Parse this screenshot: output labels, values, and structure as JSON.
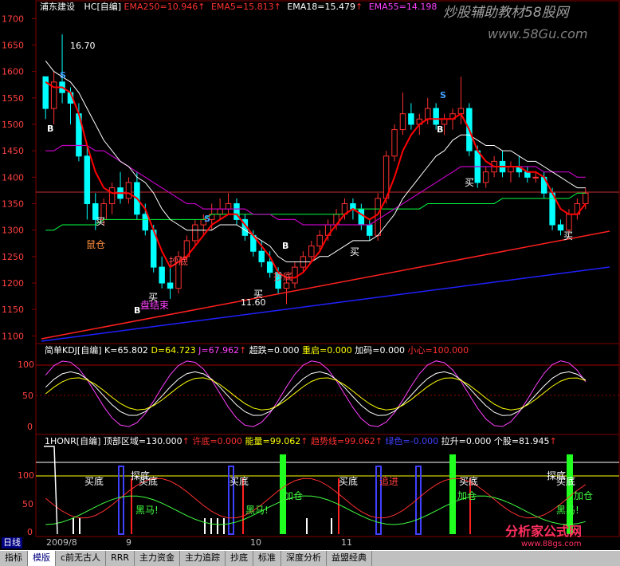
{
  "window": {
    "stock_name": "浦东建设",
    "pane1_formula": "HC[自编]",
    "ema250_label": "EMA250=10.946",
    "ema5_label": "EMA5=15.813",
    "ema18_label": "EMA18=15.479",
    "ema55_label": "EMA55=14.198",
    "arrow": "↑",
    "watermark_top": "炒股辅助教材58股网",
    "watermark_url": "www.58Gu.com",
    "watermark_bottom": "分析家公式网",
    "watermark_bottom_url": "www.88gs.com"
  },
  "colors": {
    "up": "#ff3030",
    "down": "#00ffff",
    "ema5": "#ff0000",
    "ema18": "#ffffff",
    "ema55": "#c000c0",
    "ema250": "#00ff40",
    "long1": "#ff2020",
    "long2": "#2020ff",
    "grid": "#800000"
  },
  "price_axis": {
    "ticks": [
      "1700",
      "1650",
      "1600",
      "1550",
      "1500",
      "1450",
      "1400",
      "1350",
      "1300",
      "1250",
      "1200",
      "1150",
      "1100"
    ]
  },
  "annotations": {
    "high_price": "16.70",
    "low_price": "11.60",
    "buy": "买",
    "s_mark": "S",
    "b_mark": "B",
    "mouse_cang": "鼠仓",
    "chao_di": "抄底",
    "pan_jie_shu": "盘结束"
  },
  "kdj_header": {
    "name": "简单KDJ[自编]",
    "k": "K=65.802",
    "d": "D=64.723",
    "j": "J=67.962",
    "chao_die": "超跌=0.000",
    "chong_qi": "重启=0.000",
    "jia_ma": "加码=0.000",
    "xiao_xin": "小心=100.000",
    "ticks": [
      "100",
      "50",
      "0"
    ]
  },
  "honr_header": {
    "name": "1HONR[自编]",
    "ding_bu": "顶部区域=130.000",
    "xu_di": "许底=0.000",
    "neng_liang": "能量=99.062",
    "qu_shi_xian": "趋势线=99.062",
    "lu_se": "绿色=-0.000",
    "la_sheng": "拉升=0.000",
    "ge_gu": "个股=81.945",
    "ticks": [
      "100",
      "50",
      "0"
    ],
    "mai_di": "买底",
    "tan_di": "探底",
    "hei_ma": "黑马!",
    "jia_cang": "加仓",
    "zhui_jin": "追进"
  },
  "date_axis": {
    "labels": [
      "2009/8",
      "9",
      "10",
      "11"
    ]
  },
  "tabs": [
    {
      "label": "日线",
      "active": false
    },
    {
      "label": "指标",
      "active": false
    },
    {
      "label": "模版",
      "active": true
    },
    {
      "label": "c前无古人",
      "active": false
    },
    {
      "label": "RRR",
      "active": false
    },
    {
      "label": "主力资金",
      "active": false
    },
    {
      "label": "主力追踪",
      "active": false
    },
    {
      "label": "抄底",
      "active": false
    },
    {
      "label": "标准",
      "active": false
    },
    {
      "label": "深度分析",
      "active": false
    },
    {
      "label": "益盟经典",
      "active": false
    }
  ],
  "chart_data": {
    "type": "candlestick",
    "y_axis_ticks": [
      17.0,
      16.5,
      16.0,
      15.5,
      15.0,
      14.5,
      14.0,
      13.5,
      13.0,
      12.5,
      12.0,
      11.5,
      11.0
    ],
    "ylim": [
      10.9,
      17.2
    ],
    "ohlc": [
      [
        15.9,
        15.9,
        15.1,
        15.3
      ],
      [
        15.3,
        16.0,
        15.0,
        15.8
      ],
      [
        15.8,
        16.7,
        15.4,
        15.6
      ],
      [
        15.6,
        15.7,
        15.0,
        15.4
      ],
      [
        15.2,
        15.4,
        14.3,
        14.4
      ],
      [
        14.4,
        14.6,
        13.2,
        13.5
      ],
      [
        13.5,
        13.7,
        13.0,
        13.2
      ],
      [
        13.2,
        13.6,
        13.1,
        13.5
      ],
      [
        13.5,
        13.9,
        13.3,
        13.8
      ],
      [
        13.8,
        14.1,
        13.5,
        13.6
      ],
      [
        13.6,
        14.0,
        13.5,
        13.9
      ],
      [
        13.9,
        14.1,
        13.2,
        13.3
      ],
      [
        13.3,
        13.5,
        12.9,
        13.0
      ],
      [
        13.0,
        13.1,
        12.2,
        12.3
      ],
      [
        12.3,
        12.5,
        11.9,
        12.0
      ],
      [
        12.0,
        12.3,
        11.7,
        11.9
      ],
      [
        11.9,
        12.6,
        11.8,
        12.5
      ],
      [
        12.5,
        12.9,
        12.4,
        12.8
      ],
      [
        12.8,
        13.2,
        12.7,
        13.1
      ],
      [
        13.1,
        13.3,
        12.9,
        13.2
      ],
      [
        13.2,
        13.5,
        13.0,
        13.3
      ],
      [
        13.3,
        13.6,
        13.2,
        13.4
      ],
      [
        13.4,
        13.7,
        13.3,
        13.5
      ],
      [
        13.5,
        13.6,
        13.1,
        13.2
      ],
      [
        13.2,
        13.3,
        12.8,
        12.9
      ],
      [
        12.9,
        13.0,
        12.5,
        12.6
      ],
      [
        12.6,
        12.8,
        12.3,
        12.4
      ],
      [
        12.4,
        12.6,
        12.1,
        12.2
      ],
      [
        12.2,
        12.3,
        11.8,
        11.9
      ],
      [
        11.9,
        12.1,
        11.6,
        12.0
      ],
      [
        12.0,
        12.4,
        11.9,
        12.3
      ],
      [
        12.3,
        12.6,
        12.2,
        12.5
      ],
      [
        12.5,
        12.8,
        12.4,
        12.7
      ],
      [
        12.7,
        13.0,
        12.6,
        12.9
      ],
      [
        12.9,
        13.2,
        12.8,
        13.1
      ],
      [
        13.1,
        13.4,
        13.0,
        13.3
      ],
      [
        13.3,
        13.6,
        13.2,
        13.5
      ],
      [
        13.5,
        13.6,
        13.2,
        13.4
      ],
      [
        13.4,
        13.5,
        13.0,
        13.1
      ],
      [
        13.1,
        13.2,
        12.8,
        12.9
      ],
      [
        12.9,
        13.7,
        12.8,
        13.6
      ],
      [
        13.6,
        14.5,
        13.5,
        14.4
      ],
      [
        14.4,
        15.0,
        14.3,
        14.9
      ],
      [
        14.9,
        15.6,
        14.8,
        15.2
      ],
      [
        15.2,
        15.4,
        14.9,
        15.0
      ],
      [
        15.0,
        15.2,
        14.8,
        15.1
      ],
      [
        15.1,
        15.5,
        15.0,
        15.3
      ],
      [
        15.3,
        15.4,
        14.9,
        15.0
      ],
      [
        15.0,
        15.2,
        14.8,
        15.1
      ],
      [
        15.1,
        15.3,
        14.9,
        15.2
      ],
      [
        15.2,
        15.9,
        15.0,
        15.3
      ],
      [
        15.3,
        15.4,
        14.4,
        14.5
      ],
      [
        14.5,
        14.6,
        13.8,
        13.9
      ],
      [
        13.9,
        14.2,
        13.8,
        14.1
      ],
      [
        14.1,
        14.4,
        14.0,
        14.3
      ],
      [
        14.3,
        14.5,
        14.0,
        14.1
      ],
      [
        14.1,
        14.3,
        13.9,
        14.2
      ],
      [
        14.2,
        14.4,
        14.0,
        14.1
      ],
      [
        14.1,
        14.2,
        13.9,
        14.0
      ],
      [
        14.0,
        14.1,
        13.9,
        14.0
      ],
      [
        14.0,
        14.1,
        13.6,
        13.7
      ],
      [
        13.7,
        13.8,
        13.0,
        13.1
      ],
      [
        13.1,
        13.2,
        12.9,
        13.0
      ],
      [
        13.0,
        13.4,
        12.9,
        13.3
      ],
      [
        13.3,
        13.6,
        13.2,
        13.5
      ],
      [
        13.5,
        13.8,
        13.4,
        13.7
      ]
    ],
    "ema5": [
      15.8,
      15.7,
      15.7,
      15.6,
      15.2,
      14.6,
      14.1,
      13.8,
      13.7,
      13.7,
      13.7,
      13.6,
      13.4,
      13.0,
      12.6,
      12.3,
      12.4,
      12.5,
      12.7,
      12.9,
      13.1,
      13.2,
      13.3,
      13.3,
      13.1,
      12.9,
      12.7,
      12.5,
      12.2,
      12.1,
      12.1,
      12.2,
      12.4,
      12.6,
      12.9,
      13.1,
      13.3,
      13.4,
      13.3,
      13.2,
      13.3,
      13.6,
      14.0,
      14.5,
      14.8,
      15.0,
      15.1,
      15.1,
      15.1,
      15.1,
      15.2,
      14.9,
      14.5,
      14.3,
      14.2,
      14.2,
      14.2,
      14.2,
      14.1,
      14.1,
      14.0,
      13.7,
      13.4,
      13.3,
      13.3,
      13.5
    ],
    "ema18": [
      16.2,
      16.0,
      15.9,
      15.8,
      15.6,
      15.3,
      15.0,
      14.7,
      14.5,
      14.3,
      14.2,
      14.0,
      13.9,
      13.7,
      13.4,
      13.2,
      13.1,
      13.0,
      13.0,
      13.0,
      13.0,
      13.1,
      13.1,
      13.1,
      13.0,
      12.9,
      12.8,
      12.7,
      12.5,
      12.4,
      12.4,
      12.4,
      12.4,
      12.5,
      12.5,
      12.6,
      12.7,
      12.8,
      12.8,
      12.8,
      12.9,
      13.1,
      13.3,
      13.6,
      13.8,
      14.0,
      14.2,
      14.4,
      14.5,
      14.7,
      14.8,
      14.8,
      14.7,
      14.6,
      14.6,
      14.5,
      14.5,
      14.4,
      14.3,
      14.3,
      14.2,
      14.1,
      14.0,
      13.9,
      13.8,
      13.8
    ],
    "ema55": [
      14.5,
      14.5,
      14.6,
      14.6,
      14.6,
      14.6,
      14.5,
      14.5,
      14.4,
      14.3,
      14.2,
      14.1,
      14.0,
      13.9,
      13.8,
      13.7,
      13.6,
      13.5,
      13.5,
      13.4,
      13.4,
      13.4,
      13.4,
      13.4,
      13.4,
      13.3,
      13.3,
      13.3,
      13.2,
      13.2,
      13.2,
      13.1,
      13.1,
      13.1,
      13.1,
      13.1,
      13.1,
      13.1,
      13.1,
      13.1,
      13.2,
      13.3,
      13.4,
      13.5,
      13.6,
      13.7,
      13.8,
      13.9,
      14.0,
      14.1,
      14.2,
      14.2,
      14.2,
      14.2,
      14.2,
      14.2,
      14.2,
      14.2,
      14.2,
      14.2,
      14.1,
      14.1,
      14.1,
      14.1,
      14.0,
      14.0
    ],
    "ema250": [
      13.0,
      13.0,
      13.1,
      13.1,
      13.1,
      13.1,
      13.1,
      13.2,
      13.2,
      13.2,
      13.2,
      13.2,
      13.2,
      13.2,
      13.2,
      13.2,
      13.2,
      13.2,
      13.2,
      13.2,
      13.3,
      13.3,
      13.3,
      13.3,
      13.3,
      13.3,
      13.3,
      13.3,
      13.3,
      13.3,
      13.3,
      13.3,
      13.3,
      13.3,
      13.3,
      13.3,
      13.3,
      13.4,
      13.4,
      13.4,
      13.4,
      13.4,
      13.4,
      13.4,
      13.4,
      13.4,
      13.5,
      13.5,
      13.5,
      13.5,
      13.5,
      13.5,
      13.5,
      13.5,
      13.5,
      13.6,
      13.6,
      13.6,
      13.6,
      13.6,
      13.6,
      13.6,
      13.6,
      13.6,
      13.7,
      13.7
    ]
  }
}
